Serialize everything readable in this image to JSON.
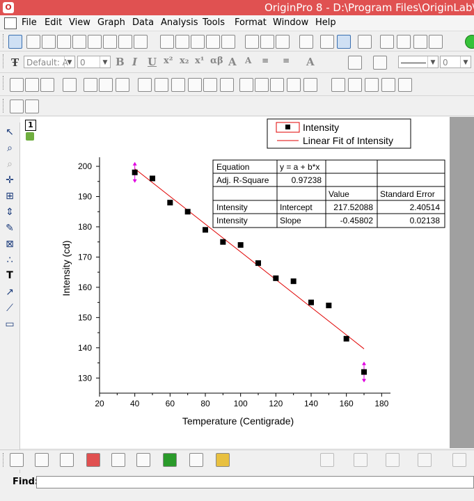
{
  "window": {
    "title": "OriginPro 8 - D:\\Program Files\\OriginLab\\O"
  },
  "menu": [
    "File",
    "Edit",
    "View",
    "Graph",
    "Data",
    "Analysis",
    "Tools",
    "Format",
    "Window",
    "Help"
  ],
  "format_toolbar": {
    "font": "Default: A",
    "size": "0",
    "size2": "0"
  },
  "layer": {
    "number": "1"
  },
  "find": {
    "label": "Find:",
    "value": ""
  },
  "colors": {
    "titlebar": "#e05151",
    "fit_line": "#e00000",
    "marker": "#000000",
    "error_bar": "#e000e0"
  },
  "legend": [
    {
      "label": "Intensity",
      "symbol": "square"
    },
    {
      "label": "Linear Fit of Intensity",
      "symbol": "line"
    }
  ],
  "fit_table": {
    "rows": [
      [
        "Equation",
        "y = a + b*x",
        "",
        ""
      ],
      [
        "Adj. R-Square",
        "0.97238",
        "",
        ""
      ],
      [
        "",
        "",
        "Value",
        "Standard Error"
      ],
      [
        "Intensity",
        "Intercept",
        "217.52088",
        "2.40514"
      ],
      [
        "Intensity",
        "Slope",
        "-0.45802",
        "0.02138"
      ]
    ]
  },
  "chart_data": {
    "type": "scatter",
    "xlabel": "Temperature (Centigrade)",
    "ylabel": "Intensity (cd)",
    "xlim": [
      20,
      185
    ],
    "ylim": [
      125,
      203
    ],
    "xticks": [
      20,
      40,
      60,
      80,
      100,
      120,
      140,
      160,
      180
    ],
    "yticks": [
      130,
      140,
      150,
      160,
      170,
      180,
      190,
      200
    ],
    "series": [
      {
        "name": "Intensity",
        "x": [
          40,
          50,
          60,
          70,
          80,
          90,
          100,
          110,
          120,
          130,
          140,
          150,
          160,
          170
        ],
        "y": [
          198,
          196,
          188,
          185,
          179,
          175,
          174,
          168,
          163,
          162,
          155,
          154,
          143,
          132
        ]
      }
    ],
    "fit": {
      "name": "Linear Fit of Intensity",
      "intercept": 217.52088,
      "slope": -0.45802,
      "x_range": [
        40,
        170
      ]
    },
    "error_bars_at_x": [
      40,
      170
    ],
    "grid": false,
    "legend_position": "top-right"
  }
}
